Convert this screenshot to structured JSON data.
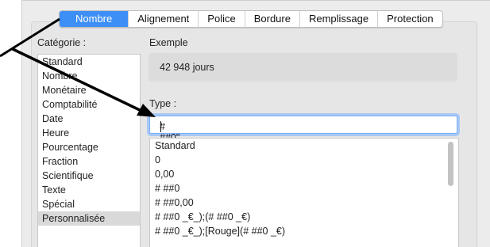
{
  "tabs": [
    {
      "label": "Nombre",
      "active": true
    },
    {
      "label": "Alignement",
      "active": false
    },
    {
      "label": "Police",
      "active": false
    },
    {
      "label": "Bordure",
      "active": false
    },
    {
      "label": "Remplissage",
      "active": false
    },
    {
      "label": "Protection",
      "active": false
    }
  ],
  "category": {
    "label": "Catégorie :",
    "items": [
      "Standard",
      "Nombre",
      "Monétaire",
      "Comptabilité",
      "Date",
      "Heure",
      "Pourcentage",
      "Fraction",
      "Scientifique",
      "Texte",
      "Spécial",
      "Personnalisée"
    ],
    "selected": "Personnalisée"
  },
  "sample": {
    "label": "Exemple",
    "value": "42 948 jours"
  },
  "type": {
    "label": "Type :",
    "value": "# ##0\" jours\""
  },
  "formats": [
    "Standard",
    "0",
    "0,00",
    "# ##0",
    "# ##0,00",
    "# ##0 _€_);(# ##0 _€)",
    "# ##0 _€_);[Rouge](# ##0 _€)"
  ],
  "colors": {
    "accent": "#3d8ff5",
    "arrow": "#000000"
  }
}
